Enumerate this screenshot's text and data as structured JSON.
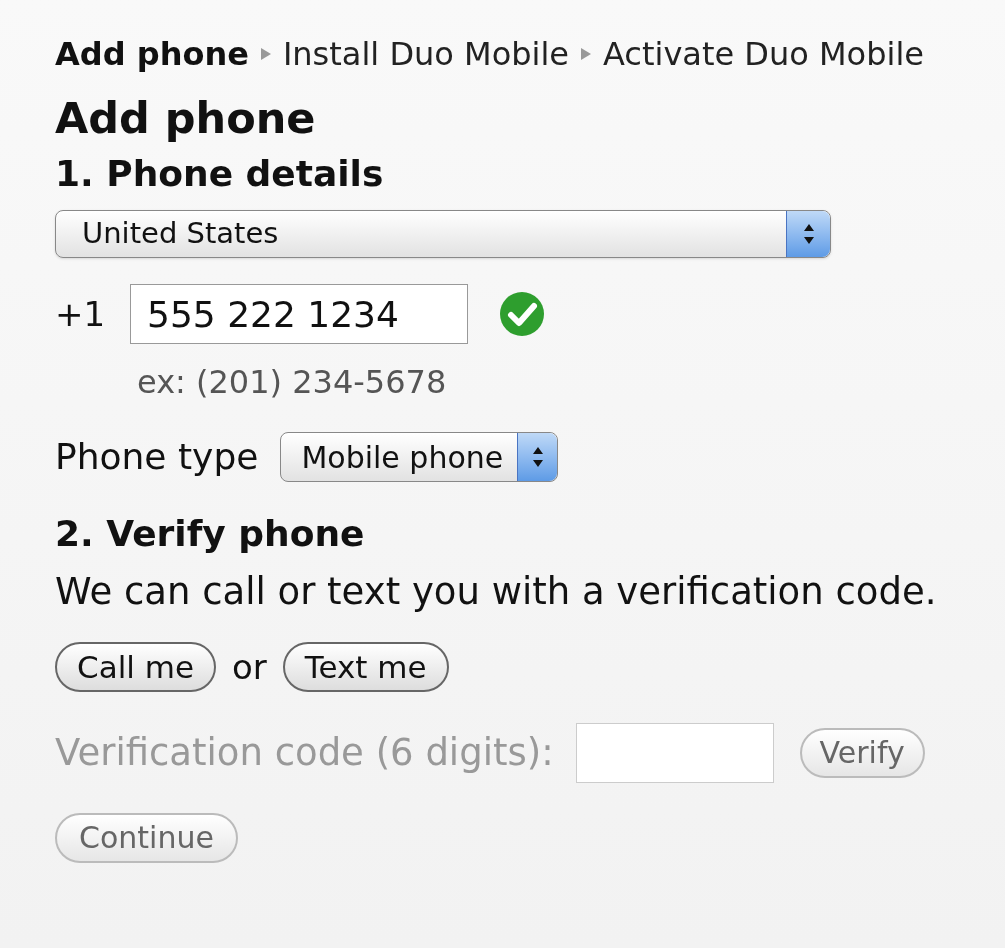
{
  "breadcrumb": [
    {
      "label": "Add phone",
      "current": true
    },
    {
      "label": "Install Duo Mobile",
      "current": false
    },
    {
      "label": "Activate Duo Mobile",
      "current": false
    }
  ],
  "title": "Add phone",
  "phone_details": {
    "heading": "1. Phone details",
    "country": "United States",
    "prefix": "+1",
    "phone_number": "555 222 1234",
    "valid": true,
    "example": "ex: (201) 234-5678",
    "phone_type_label": "Phone type",
    "phone_type": "Mobile phone"
  },
  "verify": {
    "heading": "2. Verify phone",
    "text": "We can call or text you with a verification code.",
    "call_button": "Call me",
    "or": "or",
    "text_button": "Text me",
    "code_label": "Verification code (6 digits):",
    "code_disabled": true,
    "verify_button": "Verify",
    "verify_disabled": true
  },
  "continue_button": {
    "label": "Continue",
    "disabled": true
  }
}
